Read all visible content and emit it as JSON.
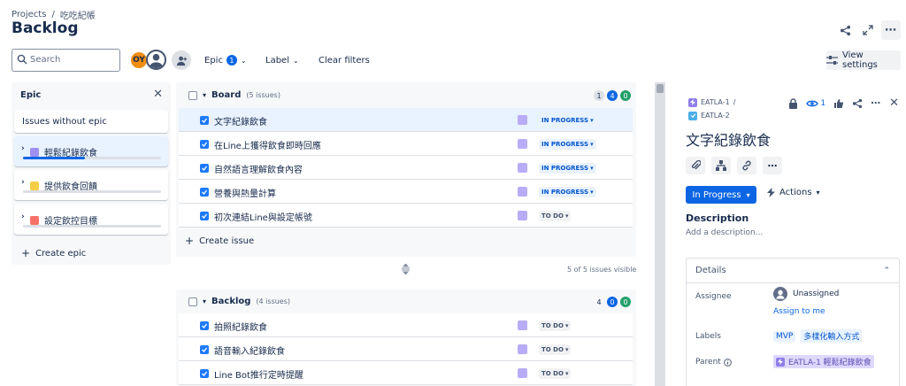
{
  "header": {
    "breadcrumb": [
      "Projects",
      "/",
      "吃吃紀帳"
    ],
    "title": "Backlog"
  },
  "toolbar": {
    "search_placeholder": "Search",
    "avatar_initials": "OY",
    "epic_filter": "Epic",
    "epic_filter_count": "1",
    "label_filter": "Label",
    "clear_filters": "Clear filters",
    "view_settings": "View settings"
  },
  "epic_panel": {
    "title": "Epic",
    "no_epic": "Issues without epic",
    "epics": [
      {
        "name": "輕鬆紀錄飲食",
        "color": "#9f8fef",
        "progress": 0.45,
        "selected": true
      },
      {
        "name": "提供飲食回饋",
        "color": "#f5cd47",
        "progress": 0,
        "selected": false
      },
      {
        "name": "設定飲控目標",
        "color": "#f87168",
        "progress": 0,
        "selected": false
      }
    ],
    "create_epic": "Create epic"
  },
  "board": {
    "title": "Board",
    "issue_count": "(5 issues)",
    "counts": [
      "1",
      "4",
      "0"
    ],
    "issues": [
      {
        "title": "文字紀錄飲食",
        "status": "IN PROGRESS",
        "selected": true
      },
      {
        "title": "在Line上獲得飲食即時回應",
        "status": "IN PROGRESS",
        "selected": false
      },
      {
        "title": "自然語言理解飲食內容",
        "status": "IN PROGRESS",
        "selected": false
      },
      {
        "title": "營養與熱量計算",
        "status": "IN PROGRESS",
        "selected": false
      },
      {
        "title": "初次連結Line與設定帳號",
        "status": "TO DO",
        "selected": false
      }
    ],
    "create_issue": "Create issue",
    "visible_count": "5 of 5 issues visible"
  },
  "backlog": {
    "title": "Backlog",
    "issue_count": "(4 issues)",
    "counts": [
      "4",
      "0",
      "0"
    ],
    "issues": [
      {
        "title": "拍照紀錄飲食",
        "status": "TO DO"
      },
      {
        "title": "語音輸入紀錄飲食",
        "status": "TO DO"
      },
      {
        "title": "Line Bot推行定時提醒",
        "status": "TO DO"
      }
    ]
  },
  "detail": {
    "parent_key": "EATLA-1",
    "parent_sep": "/",
    "key": "EATLA-2",
    "watch_count": "1",
    "title": "文字紀錄飲食",
    "status_button": "In Progress",
    "actions_button": "Actions",
    "description_heading": "Description",
    "description_placeholder": "Add a description...",
    "details_heading": "Details",
    "assignee_label": "Assignee",
    "assignee_value": "Unassigned",
    "assign_to_me": "Assign to me",
    "labels_label": "Labels",
    "labels": [
      "MVP",
      "多樣化輸入方式"
    ],
    "parent_label": "Parent",
    "parent_value": "EATLA-1 輕鬆紀錄飲食"
  }
}
